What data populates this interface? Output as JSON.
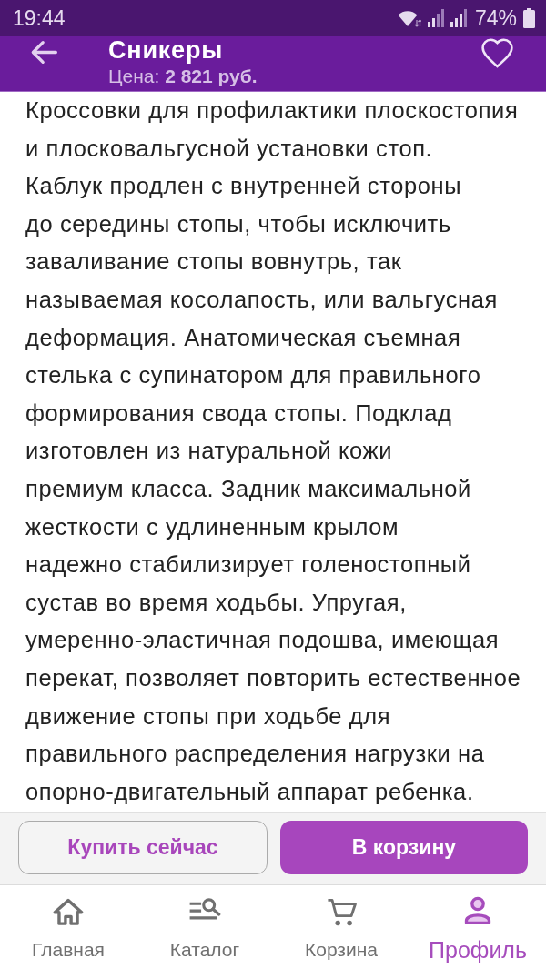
{
  "status_bar": {
    "time": "19:44",
    "battery": "74%"
  },
  "header": {
    "title": "Сникеры",
    "price": "Цена: **2 821 руб.**",
    "favorite": false
  },
  "description": "Кроссовки для профилактики плоскостопия\nи плосковальгусной установки стоп.\nКаблук продлен с внутренней стороны\nдо середины стопы, чтобы исключить\nзаваливание стопы вовнутрь, так\nназываемая косолапость, или вальгусная\nдеформация. Анатомическая съемная\nстелька с супинатором для правильного\nформирования свода стопы. Подклад\nизготовлен из натуральной кожи\nпремиум класса. Задник максимальной\nжесткости с удлиненным крылом\nнадежно стабилизирует голеностопный\nсустав во время ходьбы. Упругая,\nумеренно-эластичная подошва, имеющая\nперекат, позволяет повторить естественное\nдвижение стопы при ходьбе для\nправильного распределения нагрузки на\nопорно-двигательный аппарат ребенка.",
  "actions": [
    {
      "label": "Купить сейчас",
      "kind": "outline"
    },
    {
      "label": "В корзину",
      "kind": "filled"
    }
  ],
  "nav": [
    {
      "label": "Главная",
      "selected": false
    },
    {
      "label": "Каталог",
      "selected": false
    },
    {
      "label": "Корзина",
      "selected": false
    },
    {
      "label": "Профиль",
      "selected": true
    }
  ]
}
